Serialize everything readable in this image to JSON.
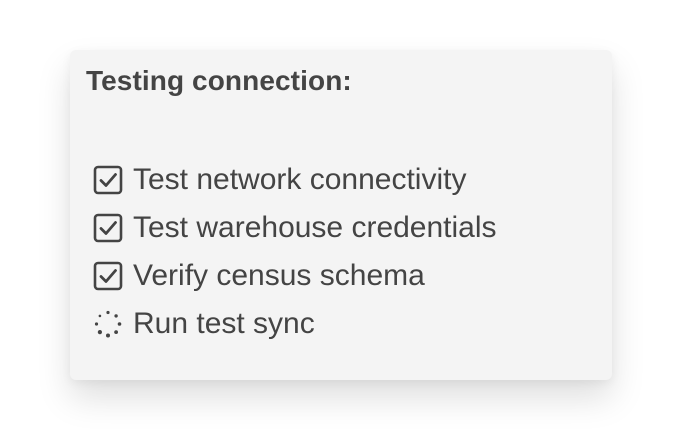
{
  "dialog": {
    "title": "Testing connection:"
  },
  "steps": [
    {
      "label": "Test network connectivity",
      "status": "done",
      "icon": "checkbox-checked-icon"
    },
    {
      "label": "Test warehouse credentials",
      "status": "done",
      "icon": "checkbox-checked-icon"
    },
    {
      "label": "Verify census schema",
      "status": "done",
      "icon": "checkbox-checked-icon"
    },
    {
      "label": "Run test sync",
      "status": "in-progress",
      "icon": "spinner-icon"
    }
  ],
  "colors": {
    "background": "#ffffff",
    "card": "#f4f4f4",
    "text": "#444444"
  }
}
